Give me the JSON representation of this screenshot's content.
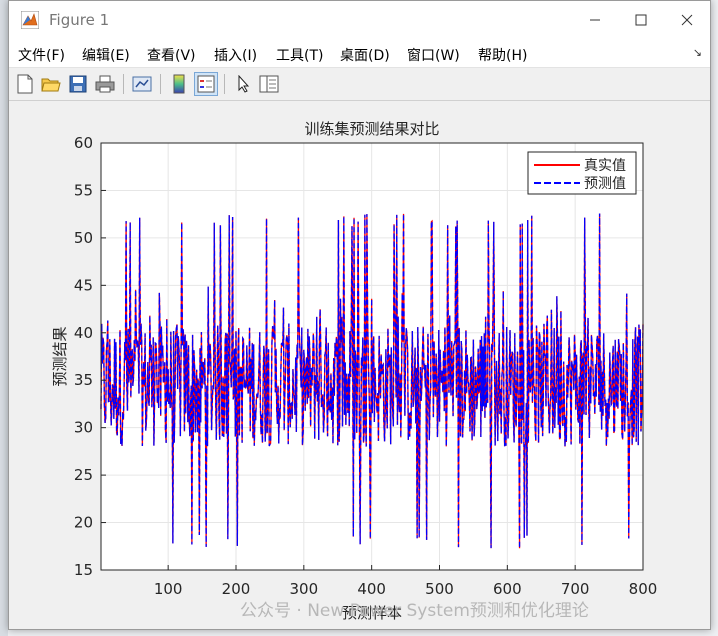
{
  "window": {
    "title": "Figure 1"
  },
  "menu": {
    "items": [
      "文件(F)",
      "编辑(E)",
      "查看(V)",
      "插入(I)",
      "工具(T)",
      "桌面(D)",
      "窗口(W)",
      "帮助(H)"
    ],
    "overflow": "↘"
  },
  "toolbar": {
    "buttons": [
      "new-figure-icon",
      "open-file-icon",
      "save-icon",
      "print-icon",
      "link-plot-icon",
      "colorbar-icon",
      "legend-icon",
      "pointer-icon",
      "property-inspector-icon"
    ]
  },
  "watermark": {
    "text": "公众号 · New Power System预测和优化理论"
  },
  "colors": {
    "true_series": "#ff0000",
    "pred_series": "#0000ff",
    "axes_bg": "#ffffff",
    "grid": "#e6e6e6"
  },
  "chart_data": {
    "type": "line",
    "title": "训练集预测结果对比",
    "xlabel": "预测样本",
    "ylabel": "预测结果",
    "xlim": [
      1,
      800
    ],
    "ylim": [
      15,
      60
    ],
    "xticks": [
      100,
      200,
      300,
      400,
      500,
      600,
      700,
      800
    ],
    "yticks": [
      15,
      20,
      25,
      30,
      35,
      40,
      45,
      50,
      55,
      60
    ],
    "grid": true,
    "legend_location": "top-right",
    "series": [
      {
        "name": "真实值",
        "color": "#ff0000",
        "style": "solid"
      },
      {
        "name": "预测值",
        "color": "#0000ff",
        "style": "dashed"
      }
    ],
    "value_range_observed": [
      17.2,
      52.6
    ],
    "sample_count": 800
  }
}
